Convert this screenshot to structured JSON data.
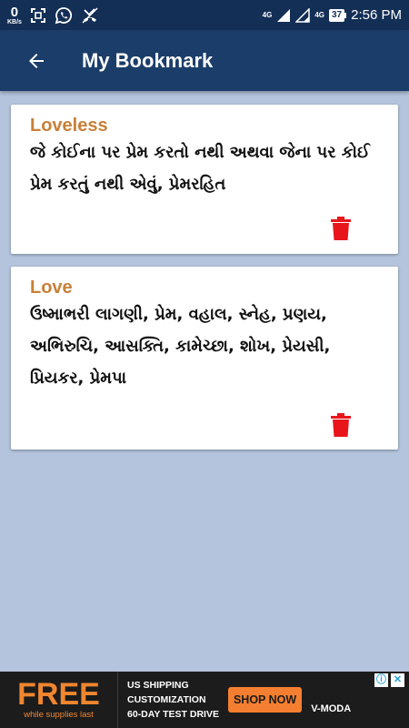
{
  "status_bar": {
    "speed_value": "0",
    "speed_unit": "KB/s",
    "network_label_1": "4G",
    "network_label_2": "4G",
    "battery_level": "37",
    "time": "2:56 PM",
    "icons": [
      "screenshot-icon",
      "whatsapp-icon",
      "missed-call-icon",
      "signal-icon",
      "wifi-calling-icon",
      "battery-icon"
    ]
  },
  "app_bar": {
    "back_icon": "arrow-back-icon",
    "title": "My Bookmark"
  },
  "bookmarks": [
    {
      "word": "Loveless",
      "meaning": "જે કોઈના પર પ્રેમ કરતો નથી અથવા જેના પર કોઈ પ્રેમ કરતું નથી એવું, પ્રેમરહિત",
      "delete_icon": "trash-icon"
    },
    {
      "word": "Love",
      "meaning": "ઉષ્માભરી લાગણી, પ્રેમ, વહાલ, સ્નેહ, પ્રણય, અભિરુચિ, આસક્તિ, કામેચ્છા, શોખ, પ્રેયસી, પ્રિયકર, પ્રેમપા",
      "delete_icon": "trash-icon"
    }
  ],
  "ad": {
    "free_text": "FREE",
    "free_subtext": "while supplies last",
    "line1": "US SHIPPING",
    "line2": "CUSTOMIZATION",
    "line3": "60-DAY TEST DRIVE",
    "cta": "SHOP NOW",
    "brand": "V-MODA",
    "info_icon": "ⓘ",
    "close_icon": "✕"
  },
  "colors": {
    "status_bar": "#142f56",
    "app_bar": "#1b3d69",
    "background": "#b4c4dc",
    "word": "#c88038",
    "delete": "#e8161b",
    "ad_accent": "#f47f30"
  }
}
